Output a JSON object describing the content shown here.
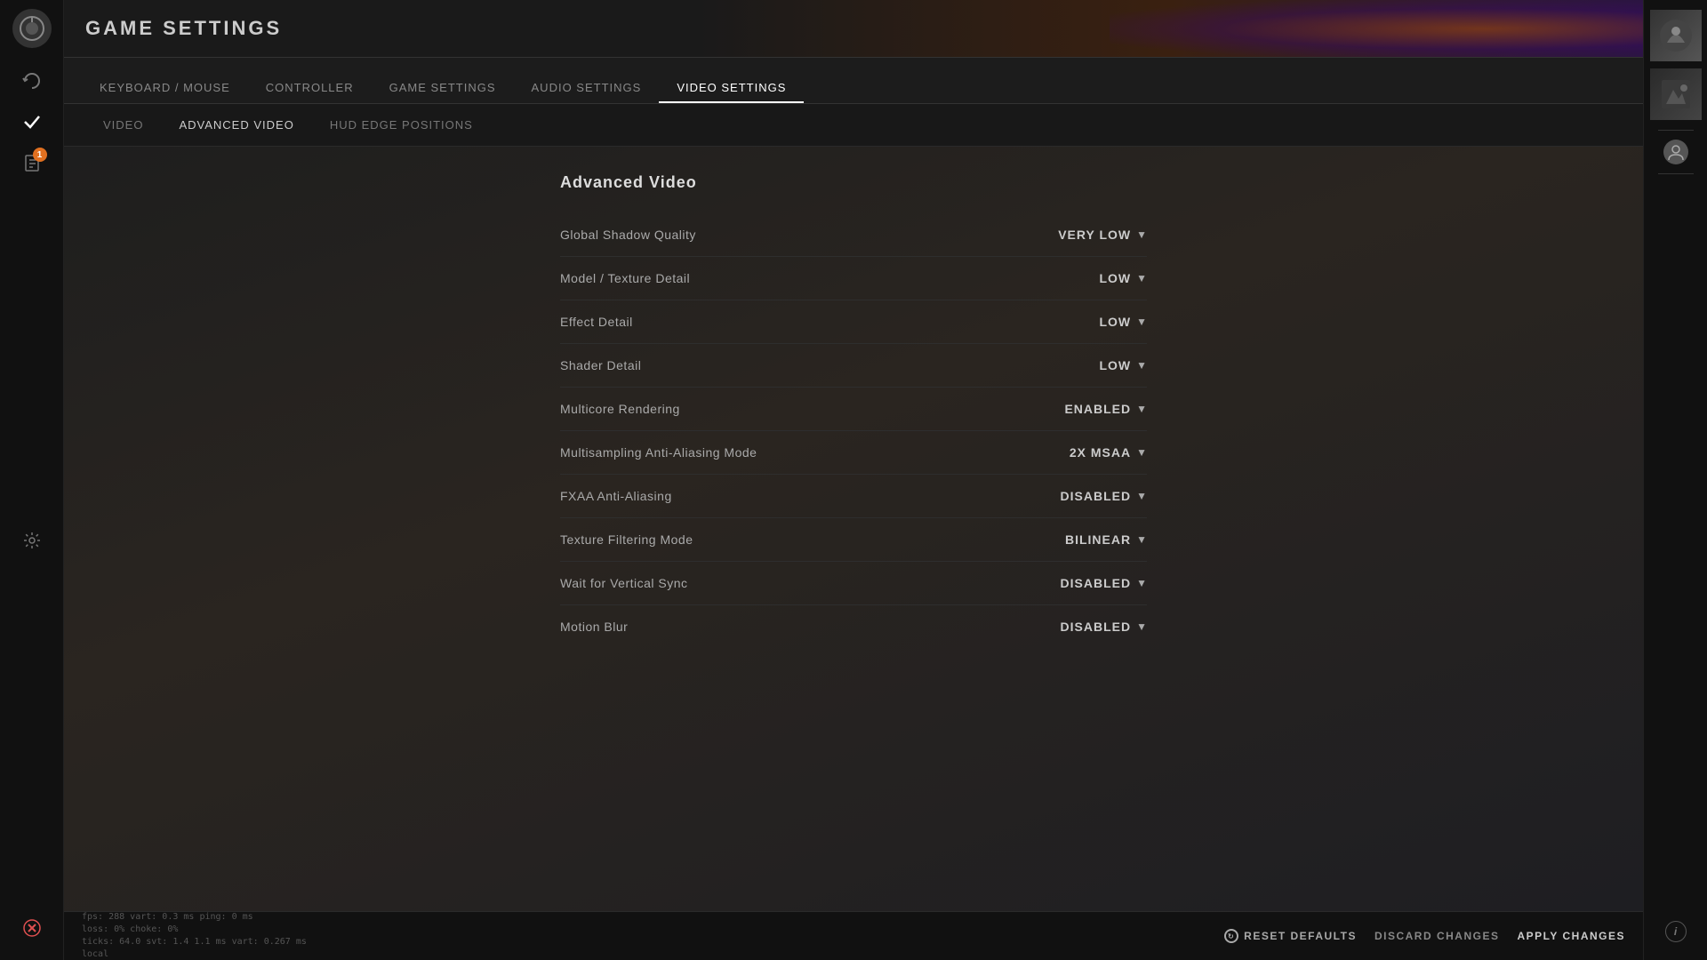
{
  "header": {
    "title": "GAME SETTINGS"
  },
  "primary_nav": {
    "items": [
      {
        "id": "keyboard-mouse",
        "label": "Keyboard / Mouse",
        "active": false
      },
      {
        "id": "controller",
        "label": "Controller",
        "active": false
      },
      {
        "id": "game-settings",
        "label": "Game settings",
        "active": false
      },
      {
        "id": "audio-settings",
        "label": "Audio Settings",
        "active": false
      },
      {
        "id": "video-settings",
        "label": "Video Settings",
        "active": true
      }
    ]
  },
  "secondary_nav": {
    "items": [
      {
        "id": "video",
        "label": "Video",
        "active": false
      },
      {
        "id": "advanced-video",
        "label": "Advanced Video",
        "active": true
      },
      {
        "id": "hud-edge",
        "label": "HUD Edge Positions",
        "active": false
      }
    ]
  },
  "section": {
    "title": "Advanced Video",
    "settings": [
      {
        "id": "global-shadow-quality",
        "label": "Global Shadow Quality",
        "value": "VERY LOW"
      },
      {
        "id": "model-texture-detail",
        "label": "Model / Texture Detail",
        "value": "LOW"
      },
      {
        "id": "effect-detail",
        "label": "Effect Detail",
        "value": "LOW"
      },
      {
        "id": "shader-detail",
        "label": "Shader Detail",
        "value": "LOW"
      },
      {
        "id": "multicore-rendering",
        "label": "Multicore Rendering",
        "value": "ENABLED"
      },
      {
        "id": "msaa-mode",
        "label": "Multisampling Anti-Aliasing Mode",
        "value": "2X MSAA"
      },
      {
        "id": "fxaa",
        "label": "FXAA Anti-Aliasing",
        "value": "DISABLED"
      },
      {
        "id": "texture-filtering",
        "label": "Texture Filtering Mode",
        "value": "BILINEAR"
      },
      {
        "id": "vsync",
        "label": "Wait for Vertical Sync",
        "value": "DISABLED"
      },
      {
        "id": "motion-blur",
        "label": "Motion Blur",
        "value": "DISABLED"
      }
    ]
  },
  "bottom_bar": {
    "debug_line1": "fps:  288  vart: 0.3 ms  ping: 0 ms",
    "debug_line2": "loss:  0%  choke:  0%",
    "debug_line3": "ticks: 64.0  svt: 1.4  1.1 ms  vart: 0.267 ms",
    "debug_line4": "local",
    "reset_label": "RESET DEFAULTS",
    "discard_label": "DISCARD CHANGES",
    "apply_label": "APPLY CHANGES"
  },
  "right_sidebar": {
    "info_icon": "i"
  }
}
